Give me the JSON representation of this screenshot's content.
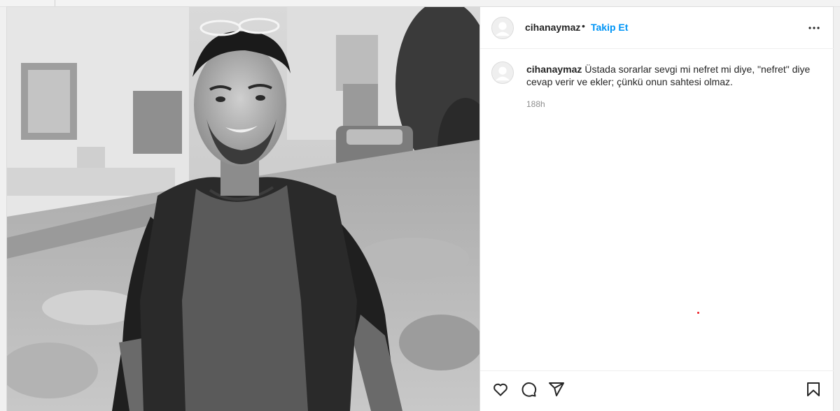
{
  "post": {
    "username": "cihanaymaz",
    "separator": "•",
    "follow_label": "Takip Et",
    "more_icon": "more-horizontal-icon",
    "photo_alt": "Siyah beyaz fotoğraf"
  },
  "caption": {
    "username": "cihanaymaz",
    "text": "Üstada sorarlar sevgi mi nefret mi diye, \"nefret\" diye cevap verir ve ekler; çünkü onun sahtesi olmaz.",
    "time": "188h"
  },
  "actions": {
    "like_icon": "heart-icon",
    "comment_icon": "comment-icon",
    "share_icon": "paper-plane-icon",
    "save_icon": "bookmark-icon"
  },
  "colors": {
    "accent": "#0095f6",
    "text": "#262626",
    "muted": "#8e8e8e",
    "border": "#dbdbdb"
  }
}
